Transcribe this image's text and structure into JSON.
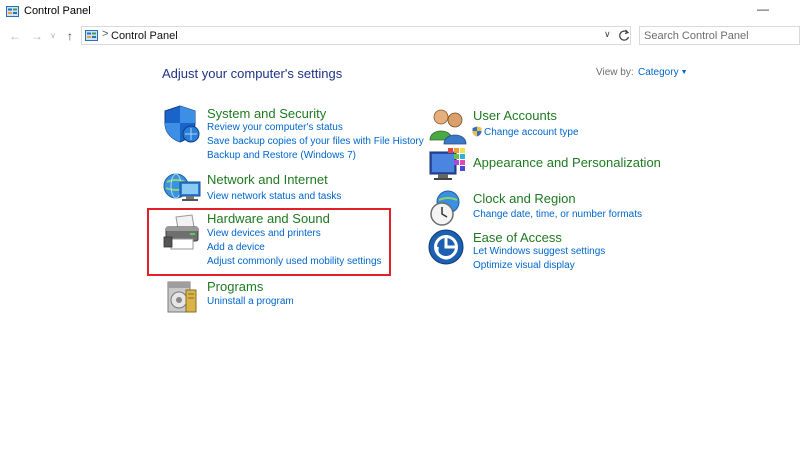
{
  "window": {
    "title": "Control Panel",
    "minimize_glyph": "—"
  },
  "nav": {
    "back_glyph": "←",
    "forward_glyph": "→",
    "up_glyph": "↑",
    "breadcrumb_separator": ">",
    "breadcrumb": "Control Panel",
    "dropdown_glyph": "∨"
  },
  "search": {
    "placeholder": "Search Control Panel"
  },
  "header": {
    "heading": "Adjust your computer's settings",
    "view_by_label": "View by:",
    "view_by_value": "Category",
    "view_by_caret": "▼"
  },
  "icons": {
    "system_security": "shield-icon",
    "network": "network-globe-icon",
    "hardware": "printer-icon",
    "programs": "programs-disk-icon",
    "user_accounts": "users-icon",
    "appearance": "appearance-icon",
    "clock": "clock-icon",
    "ease": "ease-of-access-icon"
  },
  "colors": {
    "category_title": "#1e7a20",
    "link": "#0066cc",
    "heading": "#1e3287",
    "highlight": "#e3202a"
  },
  "categories": {
    "system_security": {
      "title": "System and Security",
      "links": [
        "Review your computer's status",
        "Save backup copies of your files with File History",
        "Backup and Restore (Windows 7)"
      ]
    },
    "network": {
      "title": "Network and Internet",
      "links": [
        "View network status and tasks"
      ]
    },
    "hardware": {
      "title": "Hardware and Sound",
      "links": [
        "View devices and printers",
        "Add a device",
        "Adjust commonly used mobility settings"
      ]
    },
    "programs": {
      "title": "Programs",
      "links": [
        "Uninstall a program"
      ]
    },
    "user_accounts": {
      "title": "User Accounts",
      "links": [
        "Change account type"
      ]
    },
    "appearance": {
      "title": "Appearance and Personalization",
      "links": []
    },
    "clock": {
      "title": "Clock and Region",
      "links": [
        "Change date, time, or number formats"
      ]
    },
    "ease": {
      "title": "Ease of Access",
      "links": [
        "Let Windows suggest settings",
        "Optimize visual display"
      ]
    }
  }
}
